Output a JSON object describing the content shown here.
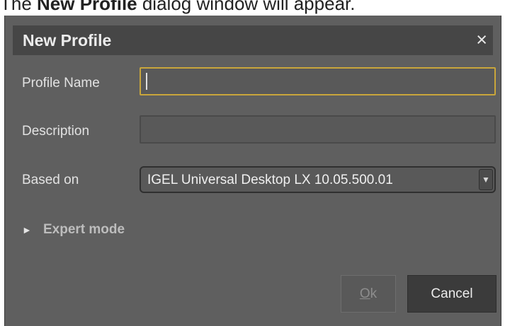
{
  "caption": {
    "prefix": "The ",
    "bold": "New Profile",
    "suffix": " dialog window will appear."
  },
  "dialog": {
    "title": "New Profile",
    "close_glyph": "×",
    "fields": {
      "profile_name_label": "Profile Name",
      "profile_name_value": "",
      "description_label": "Description",
      "description_value": "",
      "based_on_label": "Based on",
      "based_on_value": "IGEL Universal Desktop LX 10.05.500.01"
    },
    "expert_mode_label": "Expert mode",
    "expert_mode_expanded": false,
    "buttons": {
      "ok_label": "Ok",
      "ok_mnemonic": "O",
      "ok_rest": "k",
      "cancel_label": "Cancel"
    }
  },
  "icons": {
    "close": "close-icon",
    "dropdown": "chevron-down-icon",
    "expander": "triangle-right-icon"
  }
}
